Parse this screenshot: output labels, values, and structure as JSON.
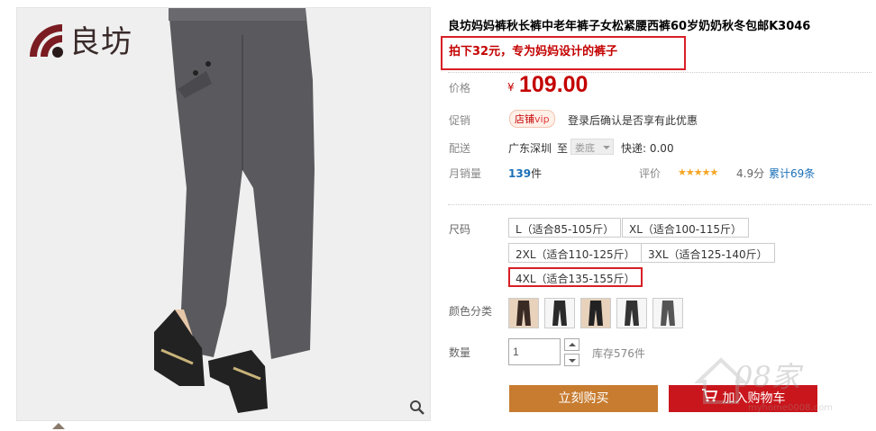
{
  "brand": {
    "logo_text": "良坊"
  },
  "product": {
    "title": "良坊妈妈裤秋长裤中老年裤子女松紧腰西裤60岁奶奶秋冬包邮K3046",
    "promo": "拍下32元，专为妈妈设计的裤子"
  },
  "price": {
    "label": "价格",
    "currency": "¥",
    "value": "109.00"
  },
  "promotion": {
    "label": "促销",
    "badge_shop": "店铺",
    "badge_vip": "vip",
    "note": "登录后确认是否享有此优惠"
  },
  "shipping": {
    "label": "配送",
    "from": "广东深圳",
    "to_word": "至",
    "dest": "娄底",
    "fee": "快递: 0.00"
  },
  "sales": {
    "label": "月销量",
    "count": "139",
    "unit": "件",
    "rating_label": "评价",
    "stars": "★★★★★",
    "score": "4.9分",
    "reviews": "累计69条"
  },
  "sizes": {
    "label": "尺码",
    "options": [
      "L（适合85-105斤）",
      "XL（适合100-115斤）",
      "2XL（适合110-125斤）",
      "3XL（适合125-140斤）",
      "4XL（适合135-155斤）"
    ],
    "selected_index": 4
  },
  "colors": {
    "label": "颜色分类"
  },
  "quantity": {
    "label": "数量",
    "value": "1",
    "stock": "库存576件"
  },
  "actions": {
    "buy_now": "立刻购买",
    "add_to_cart": "加入购物车"
  },
  "watermark": {
    "text": "08家",
    "url": "myhome0008.com"
  },
  "colors_theme": {
    "accent_red": "#c40000",
    "buy_orange": "#c77c30",
    "cart_red": "#c9161c",
    "link_blue": "#1a6fb8"
  }
}
